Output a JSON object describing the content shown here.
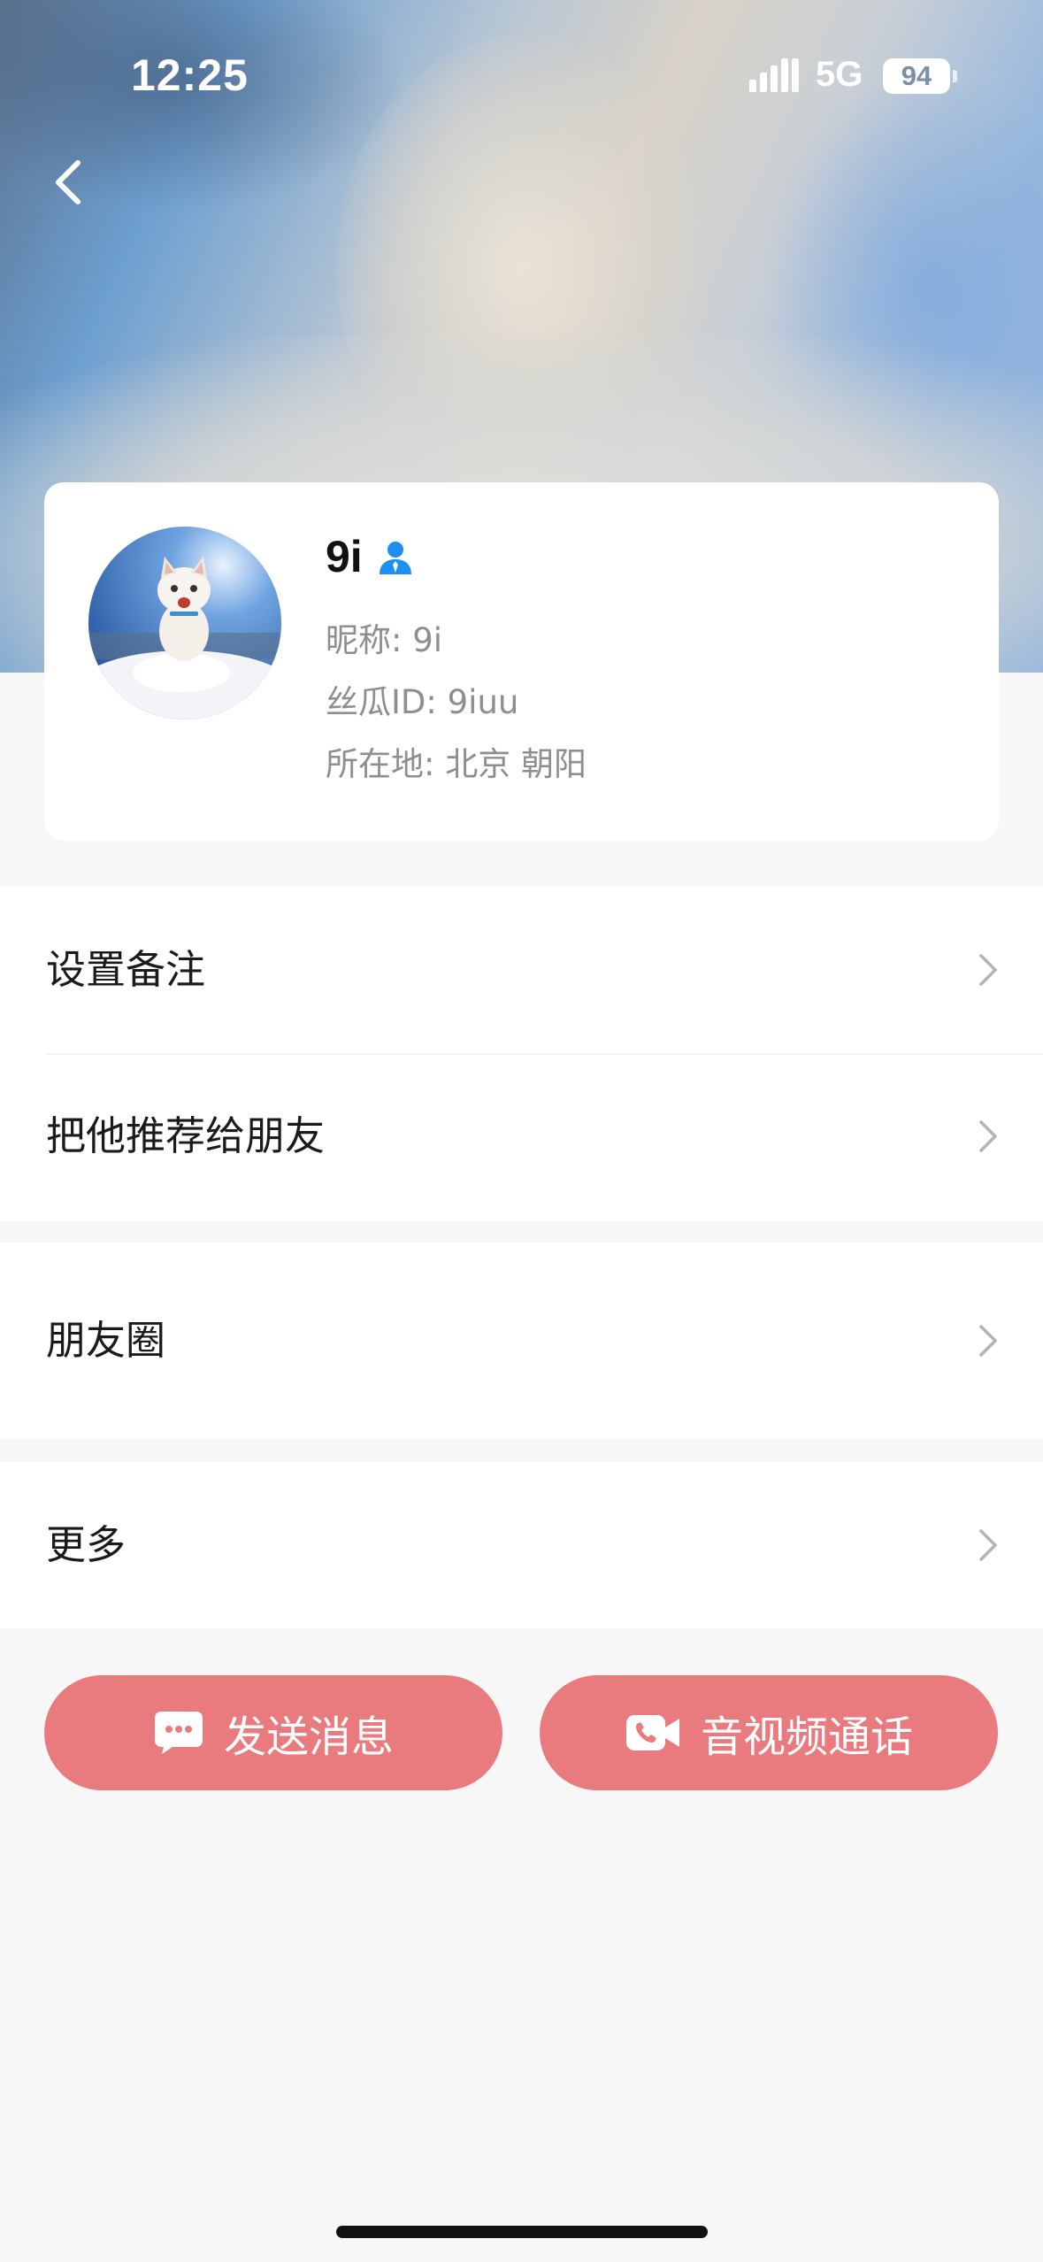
{
  "status_bar": {
    "time": "12:25",
    "network": "5G",
    "battery": "94"
  },
  "profile": {
    "name": "9i",
    "nickname": "昵称: 9i",
    "user_id": "丝瓜ID: 9iuu",
    "location": "所在地: 北京 朝阳",
    "accent_color": "#1e8ff0"
  },
  "menu": {
    "set_remark": "设置备注",
    "recommend": "把他推荐给朋友",
    "moments": "朋友圈",
    "more": "更多"
  },
  "actions": {
    "send_message": "发送消息",
    "av_call": "音视频通话",
    "button_color": "#e97a7e"
  },
  "icons": {
    "back": "chevron-left-icon",
    "verify": "person-badge-icon",
    "chevron": "chevron-right-icon",
    "message": "chat-bubble-icon",
    "call": "video-phone-icon"
  }
}
